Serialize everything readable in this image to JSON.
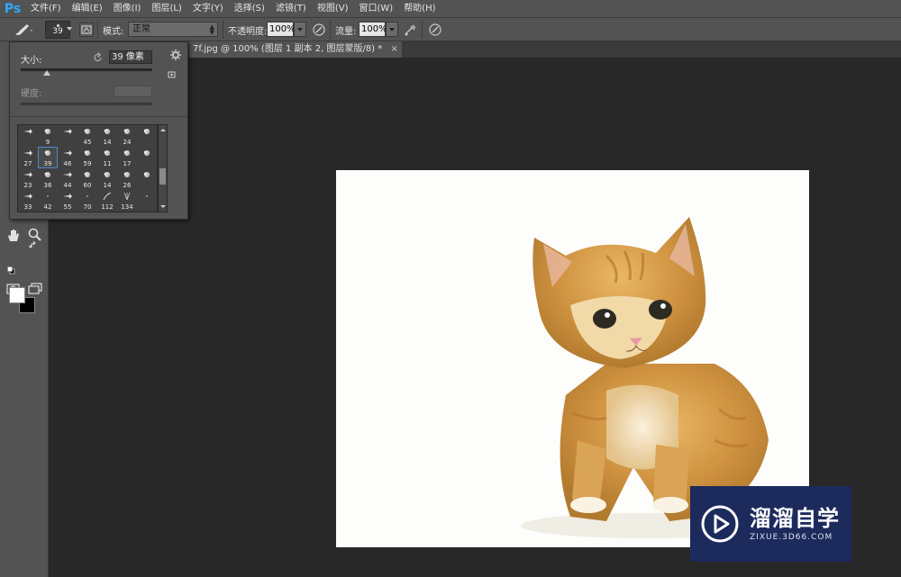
{
  "app": {
    "logo": "Ps"
  },
  "menu": [
    "文件(F)",
    "编辑(E)",
    "图像(I)",
    "图层(L)",
    "文字(Y)",
    "选择(S)",
    "滤镜(T)",
    "视图(V)",
    "窗口(W)",
    "帮助(H)"
  ],
  "options": {
    "brush_size": "39",
    "mode_label": "模式:",
    "mode_value": "正常",
    "opacity_label": "不透明度:",
    "opacity_value": "100%",
    "flow_label": "流量:",
    "flow_value": "100%"
  },
  "document_tab": {
    "title": "7f.jpg @ 100% (图层 1 副本 2, 图层蒙版/8) *",
    "close": "×"
  },
  "brush_panel": {
    "size_label": "大小:",
    "size_value": "39 像素",
    "hardness_label": "硬度:",
    "size_level_fraction": 0.19,
    "presets": [
      {
        "n": ""
      },
      {
        "n": "9"
      },
      {
        "n": ""
      },
      {
        "n": "45"
      },
      {
        "n": "14"
      },
      {
        "n": "24"
      },
      {
        "n": ""
      },
      {
        "n": "27"
      },
      {
        "n": "39"
      },
      {
        "n": "46"
      },
      {
        "n": "59"
      },
      {
        "n": "11"
      },
      {
        "n": "17"
      },
      {
        "n": ""
      },
      {
        "n": "23"
      },
      {
        "n": "36"
      },
      {
        "n": "44"
      },
      {
        "n": "60"
      },
      {
        "n": "14"
      },
      {
        "n": "26"
      },
      {
        "n": ""
      },
      {
        "n": "33"
      },
      {
        "n": "42"
      },
      {
        "n": "55"
      },
      {
        "n": "70"
      },
      {
        "n": "112"
      },
      {
        "n": "134"
      },
      {
        "n": ""
      }
    ],
    "selected_index": 8
  },
  "colors": {
    "foreground": "#ffffff",
    "background": "#000000",
    "accent": "#31a8ff"
  },
  "watermark": {
    "title": "溜溜自学",
    "url": "ZIXUE.3D66.COM"
  }
}
